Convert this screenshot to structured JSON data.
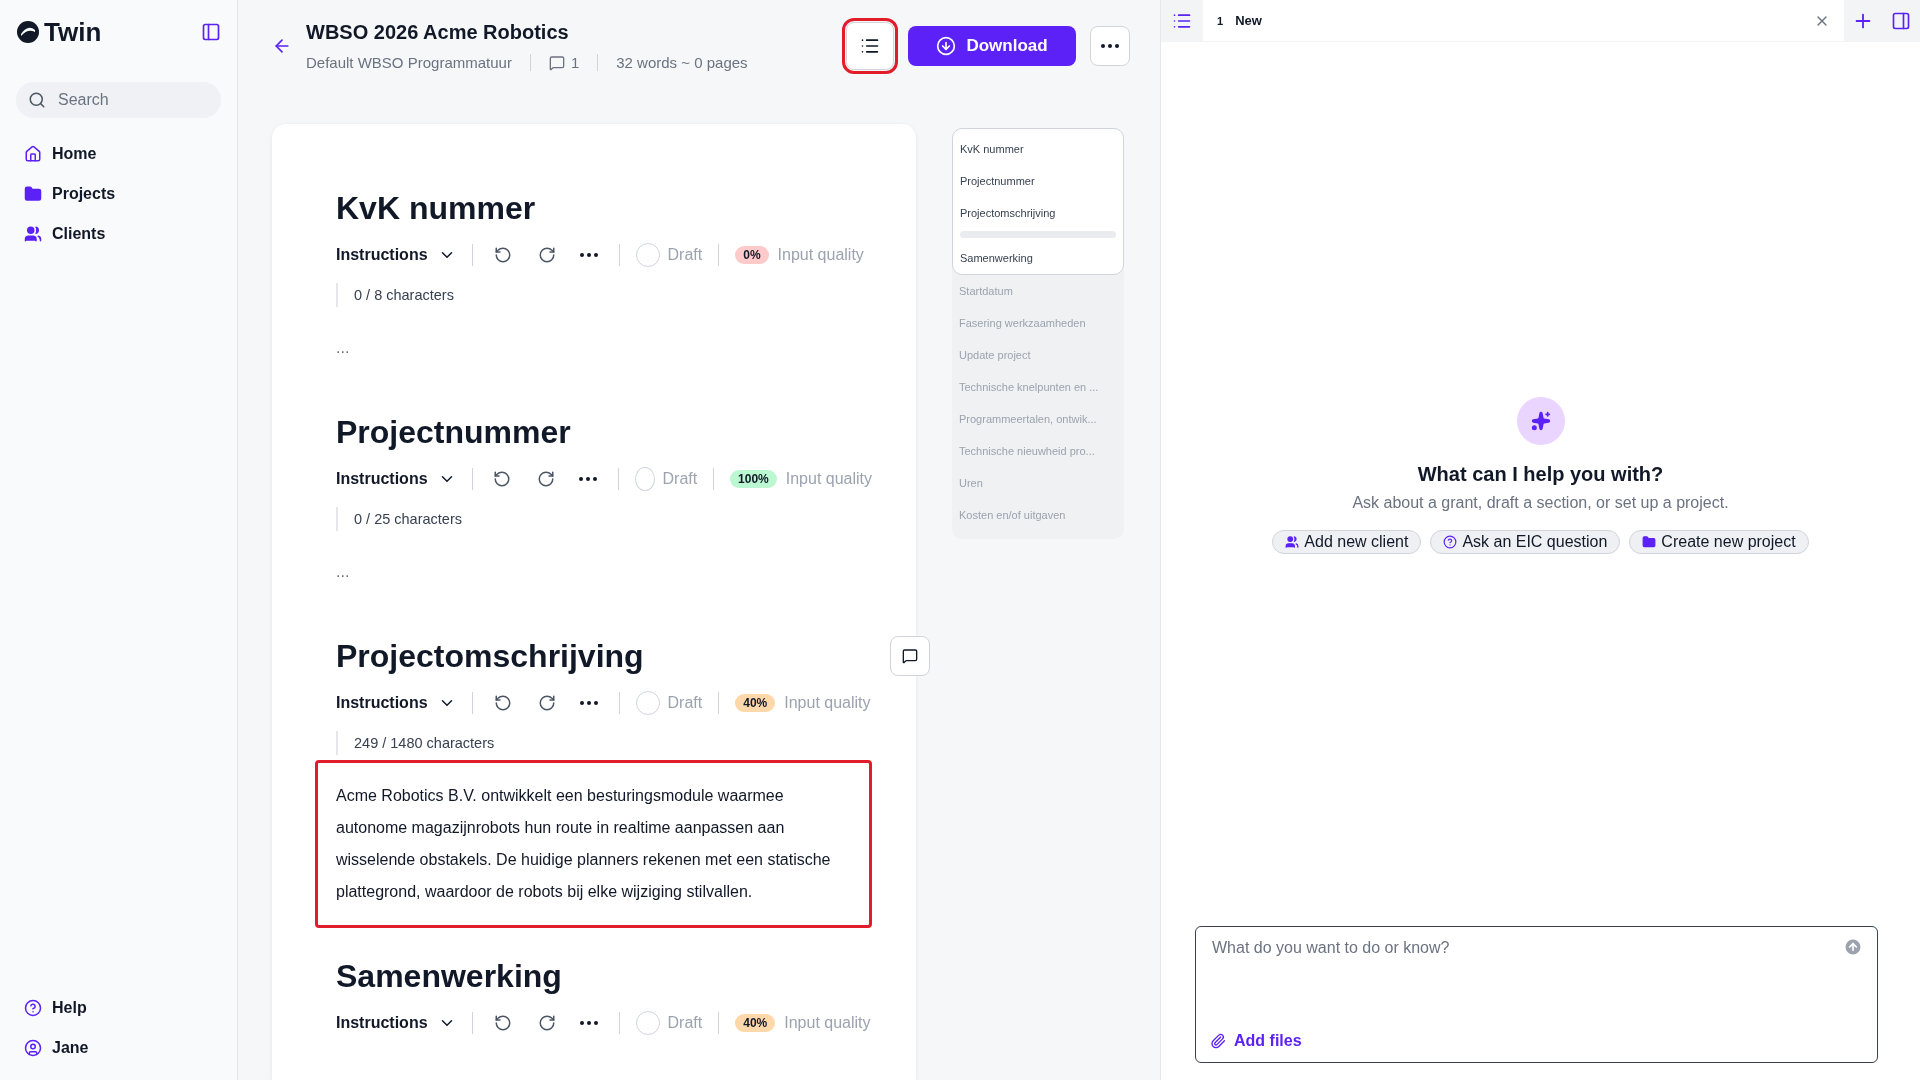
{
  "sidebar": {
    "brand": "Twin",
    "search": {
      "placeholder": "Search"
    },
    "nav": [
      {
        "label": "Home"
      },
      {
        "label": "Projects"
      },
      {
        "label": "Clients"
      }
    ],
    "footer": [
      {
        "label": "Help"
      },
      {
        "label": "Jane"
      }
    ]
  },
  "header": {
    "title": "WBSO 2026 Acme Robotics",
    "template": "Default WBSO Programmatuur",
    "comments": "1",
    "stats": "32 words ~ 0 pages",
    "outline_button": {
      "highlighted": true
    },
    "download": "Download"
  },
  "sections": [
    {
      "title": "KvK nummer",
      "instructions": "Instructions",
      "draft": false,
      "status": "Draft",
      "quality": "0%",
      "quality_label": "Input quality",
      "color": "#fecaca",
      "characters": "0 / 8 characters",
      "body": "...",
      "empty": true,
      "highlighted": false,
      "comment_button": false
    },
    {
      "title": "Projectnummer",
      "instructions": "Instructions",
      "draft": false,
      "status": "Draft",
      "quality": "100%",
      "quality_label": "Input quality",
      "color": "#bbf7d0",
      "characters": "0 / 25 characters",
      "body": "...",
      "empty": true,
      "highlighted": false,
      "comment_button": false
    },
    {
      "title": "Projectomschrijving",
      "instructions": "Instructions",
      "draft": false,
      "status": "Draft",
      "quality": "40%",
      "quality_label": "Input quality",
      "color": "#fed7aa",
      "characters": "249 / 1480 characters",
      "body": "Acme Robotics B.V. ontwikkelt een besturingsmodule waarmee autonome magazijnrobots hun route in realtime aanpassen aan wisselende obstakels. De huidige planners rekenen met een statische plattegrond, waardoor de robots bij elke wijziging stilvallen.",
      "empty": false,
      "highlighted": true,
      "comment_button": true
    },
    {
      "title": "Samenwerking",
      "instructions": "Instructions",
      "draft": false,
      "status": "Draft",
      "quality": "40%",
      "quality_label": "Input quality",
      "color": "#fed7aa"
    }
  ],
  "outline": [
    {
      "label": "KvK nummer",
      "in_view": true
    },
    {
      "label": "Projectnummer",
      "in_view": true
    },
    {
      "label": "Projectomschrijving",
      "in_view": true
    },
    {
      "label": "Samenwerking",
      "in_view": true
    },
    {
      "label": "Startdatum",
      "in_view": false
    },
    {
      "label": "Fasering werkzaamheden",
      "in_view": false
    },
    {
      "label": "Update project",
      "in_view": false
    },
    {
      "label": "Technische knelpunten en ...",
      "in_view": false
    },
    {
      "label": "Programmeertalen, ontwik...",
      "in_view": false
    },
    {
      "label": "Technische nieuwheid pro...",
      "in_view": false
    },
    {
      "label": "Uren",
      "in_view": false
    },
    {
      "label": "Kosten en/of uitgaven",
      "in_view": false
    }
  ],
  "chat": {
    "tabs": [
      {
        "number": "1",
        "label": "New",
        "selected": true
      }
    ],
    "title": "What can I help you with?",
    "subtitle": "Ask about a grant, draft a section, or set up a project.",
    "suggestions": [
      {
        "label": "Add new client"
      },
      {
        "label": "Ask an EIC question"
      },
      {
        "label": "Create new project"
      }
    ],
    "input": {
      "placeholder": "What do you want to do or know?"
    },
    "add_files": "Add files"
  }
}
